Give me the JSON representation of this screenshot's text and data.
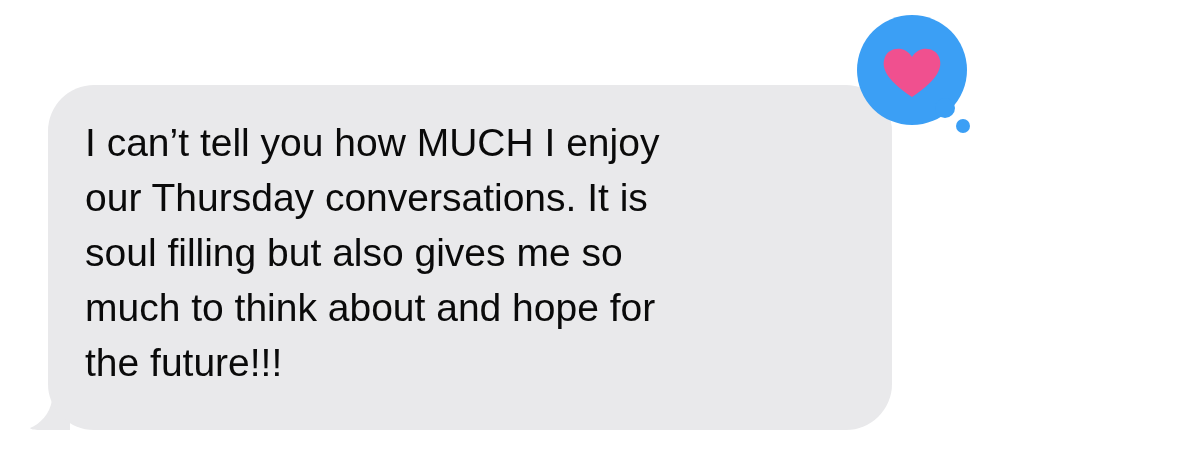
{
  "message": {
    "text": "I can’t tell you how MUCH I enjoy\nour Thursday conversations. It is\nsoul filling but also gives me so\nmuch to think about and hope for\nthe future!!!",
    "tapback": {
      "kind": "heart"
    }
  }
}
